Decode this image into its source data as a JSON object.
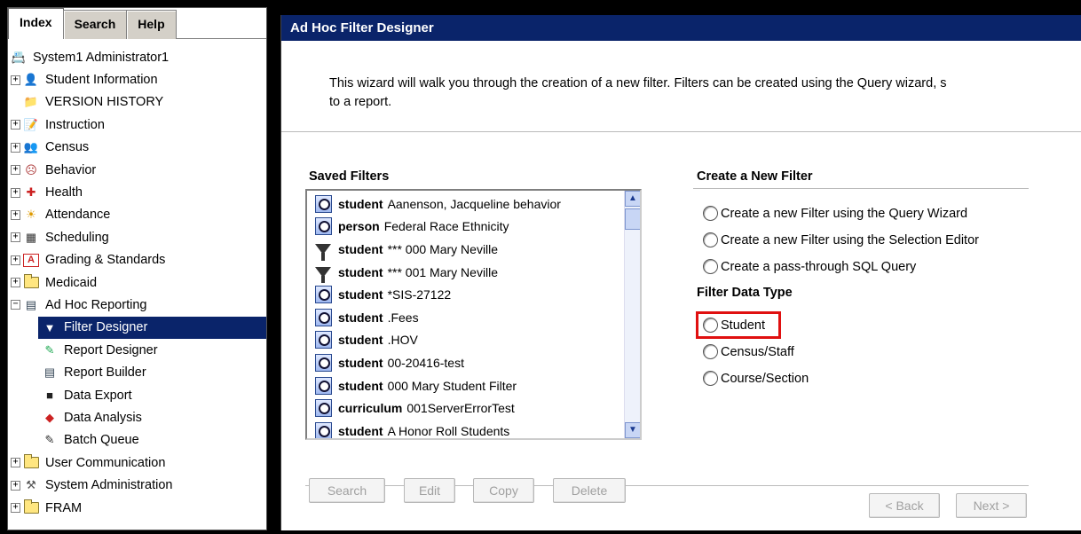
{
  "left_tabs": [
    "Index",
    "Search",
    "Help"
  ],
  "tree": [
    {
      "label": "System1 Administrator1",
      "icon": "user-card-icon",
      "exp": "",
      "indent": 0
    },
    {
      "label": "Student Information",
      "icon": "student-icon",
      "exp": "+",
      "indent": 0
    },
    {
      "label": "VERSION HISTORY",
      "icon": "folder-user-icon",
      "exp": " ",
      "indent": 0
    },
    {
      "label": "Instruction",
      "icon": "instruction-icon",
      "exp": "+",
      "indent": 0
    },
    {
      "label": "Census",
      "icon": "census-icon",
      "exp": "+",
      "indent": 0
    },
    {
      "label": "Behavior",
      "icon": "behavior-icon",
      "exp": "+",
      "indent": 0
    },
    {
      "label": "Health",
      "icon": "health-icon",
      "exp": "+",
      "indent": 0
    },
    {
      "label": "Attendance",
      "icon": "attendance-icon",
      "exp": "+",
      "indent": 0
    },
    {
      "label": "Scheduling",
      "icon": "scheduling-icon",
      "exp": "+",
      "indent": 0
    },
    {
      "label": "Grading & Standards",
      "icon": "grading-icon",
      "exp": "+",
      "indent": 0
    },
    {
      "label": "Medicaid",
      "icon": "folder-icon",
      "exp": "+",
      "indent": 0
    },
    {
      "label": "Ad Hoc Reporting",
      "icon": "report-icon",
      "exp": "−",
      "indent": 0
    },
    {
      "label": "Filter Designer",
      "icon": "filter-icon",
      "exp": "",
      "indent": 1,
      "selected": true
    },
    {
      "label": "Report Designer",
      "icon": "report-designer-icon",
      "exp": "",
      "indent": 1
    },
    {
      "label": "Report Builder",
      "icon": "report-builder-icon",
      "exp": "",
      "indent": 1
    },
    {
      "label": "Data Export",
      "icon": "disk-icon",
      "exp": "",
      "indent": 1
    },
    {
      "label": "Data Analysis",
      "icon": "cube-icon",
      "exp": "",
      "indent": 1
    },
    {
      "label": "Batch Queue",
      "icon": "batch-icon",
      "exp": "",
      "indent": 1
    },
    {
      "label": "User Communication",
      "icon": "folder-icon",
      "exp": "+",
      "indent": 0
    },
    {
      "label": "System Administration",
      "icon": "admin-icon",
      "exp": "+",
      "indent": 0
    },
    {
      "label": "FRAM",
      "icon": "folder-icon",
      "exp": "+",
      "indent": 0
    }
  ],
  "main": {
    "title": "Ad Hoc Filter Designer",
    "intro_line1": "This wizard will walk you through the creation of a new filter. Filters can be created using the Query wizard, s",
    "intro_line2": "to a report.",
    "saved_heading": "Saved Filters",
    "create_heading": "Create a New Filter",
    "type_heading": "Filter Data Type",
    "saved_filters": [
      {
        "type": "student",
        "name": "Aanenson, Jacqueline behavior",
        "icon": "query-icon"
      },
      {
        "type": "person",
        "name": "Federal Race Ethnicity",
        "icon": "query-icon"
      },
      {
        "type": "student",
        "name": "*** 000 Mary Neville",
        "icon": "funnel-icon"
      },
      {
        "type": "student",
        "name": "*** 001 Mary Neville",
        "icon": "funnel-icon"
      },
      {
        "type": "student",
        "name": "*SIS-27122",
        "icon": "query-icon"
      },
      {
        "type": "student",
        "name": ".Fees",
        "icon": "query-icon"
      },
      {
        "type": "student",
        "name": ".HOV",
        "icon": "query-icon"
      },
      {
        "type": "student",
        "name": "00-20416-test",
        "icon": "query-icon"
      },
      {
        "type": "student",
        "name": "000 Mary Student Filter",
        "icon": "query-icon"
      },
      {
        "type": "curriculum",
        "name": "001ServerErrorTest",
        "icon": "query-icon"
      },
      {
        "type": "student",
        "name": "A Honor Roll Students",
        "icon": "query-icon"
      }
    ],
    "create_options": [
      "Create a new Filter using the Query Wizard",
      "Create a new Filter using the Selection Editor",
      "Create a pass-through SQL Query"
    ],
    "data_types": [
      "Student",
      "Census/Staff",
      "Course/Section"
    ],
    "buttons": {
      "search": "Search",
      "edit": "Edit",
      "copy": "Copy",
      "delete": "Delete",
      "back": "< Back",
      "next": "Next >"
    }
  },
  "colors": {
    "title_bar": "#0a246a",
    "highlight_box": "#e01010",
    "selected_tree": "#0a246a"
  }
}
